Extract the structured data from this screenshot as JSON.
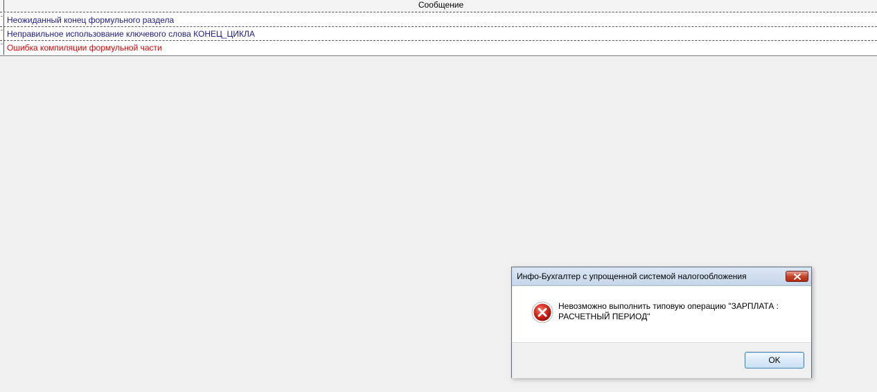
{
  "grid": {
    "column_header": "Сообщение",
    "rows": [
      {
        "text": "Неожиданный конец формульного раздела",
        "color": "#1a1a8c"
      },
      {
        "text": "Неправильное использование ключевого слова КОНЕЦ_ЦИКЛА",
        "color": "#1a1a8c"
      },
      {
        "text": "Ошибка компиляции формульной части",
        "color": "#e60000"
      }
    ]
  },
  "dialog": {
    "title": "Инфо-Бухгалтер с упрощенной системой налогообложения",
    "icon": "error-icon",
    "message_line1": "Невозможно выполнить типовую операцию \"ЗАРПЛАТА :",
    "message_line2": "РАСЧЕТНЫЙ ПЕРИОД\"",
    "ok_label": "OK"
  }
}
